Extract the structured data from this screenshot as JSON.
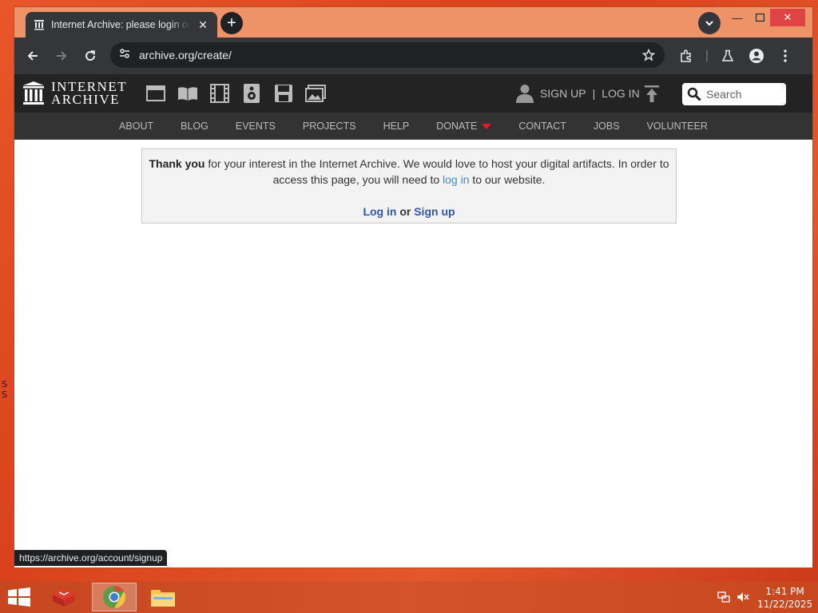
{
  "browser": {
    "tab_title": "Internet Archive: please login or sign up",
    "url": "archive.org/create/",
    "status_url": "https://archive.org/account/signup"
  },
  "site": {
    "logo_line1": "INTERNET",
    "logo_line2": "ARCHIVE",
    "media_icons": [
      "web-icon",
      "texts-icon",
      "video-icon",
      "audio-icon",
      "software-icon",
      "images-icon"
    ],
    "sign_up_label": "SIGN UP",
    "separator": "|",
    "log_in_label": "LOG IN",
    "search_placeholder": "Search",
    "nav": [
      "ABOUT",
      "BLOG",
      "EVENTS",
      "PROJECTS",
      "HELP",
      "DONATE",
      "CONTACT",
      "JOBS",
      "VOLUNTEER"
    ]
  },
  "notice": {
    "lead": "Thank you",
    "text1": " for your interest in the Internet Archive. We would love to host your digital artifacts. In order to access this page, you will need to ",
    "link": "log in",
    "text2": " to our website.",
    "login_label": "Log in",
    "or_label": "or",
    "signup_label": "Sign up"
  },
  "taskbar": {
    "time": "1:41 PM",
    "date": "11/22/2025"
  },
  "colors": {
    "desktop": "#e8562a",
    "ia_header": "#232323",
    "ia_nav": "#333333",
    "donate_caret": "#e01b22",
    "link": "#428bca"
  }
}
